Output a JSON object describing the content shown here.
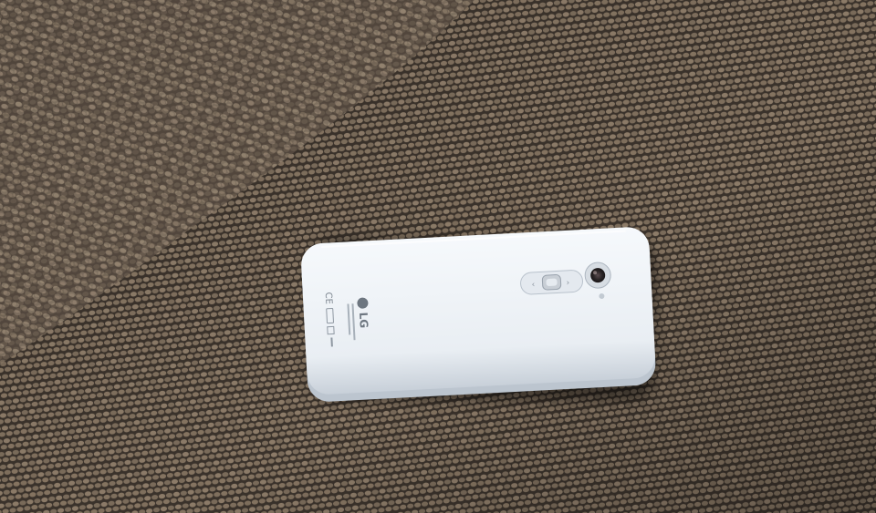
{
  "scene": {
    "description_free": true,
    "colors": {
      "fabric_light": "#8a7a68",
      "fabric_mid": "#6b5d4f",
      "fabric_dark": "#2e2823",
      "phone_body": "#eef2f6",
      "phone_shadow": "#c9d1da",
      "lens_ring": "#d9dee4",
      "lens": "#2a2526"
    },
    "phone": {
      "brand_text": "LG",
      "marks": "CE"
    }
  }
}
